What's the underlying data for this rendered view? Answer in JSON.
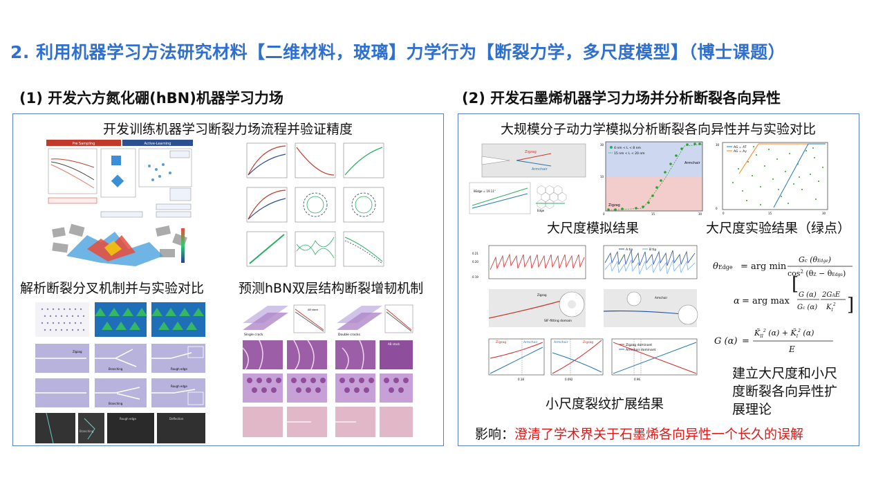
{
  "page": {
    "title": "2. 利用机器学习方法研究材料【二维材料，玻璃】力学行为【断裂力学，多尺度模型】（博士课题）"
  },
  "left": {
    "heading": "(1) 开发六方氮化硼(hBN)机器学习力场",
    "cap_top": "开发训练机器学习断裂力场流程并验证精度",
    "cap_bottom_left": "解析断裂分叉机制并与实验对比",
    "cap_bottom_right": "预测hBN双层结构断裂增韧机制"
  },
  "right": {
    "heading": "(2) 开发石墨烯机器学习力场并分析断裂各向异性",
    "cap_top": "大规模分子动力学模拟分析断裂各向异性并与实验对比",
    "cap_sim": "大尺度模拟结果",
    "cap_exp": "大尺度实验结果（绿点）",
    "cap_crack": "小尺度裂纹扩展结果",
    "cap_theory": [
      "建立大尺度和小尺",
      "度断裂各向异性扩",
      "展理论"
    ],
    "impact_label": "影响：",
    "impact_text": "澄清了学术界关于石墨烯各向异性一个长久的误解"
  },
  "figure_labels": {
    "pre_sampling": "Pre Sampling",
    "active_learning": "Active-Learning",
    "zigzag": "Zigzag",
    "armchair": "Armchair",
    "branching": "Branching",
    "rough_edge": "Rough edge",
    "deflection": "Deflection",
    "single_crack": "Single crack",
    "double_cracks": "Double cracks",
    "ab_stack": "AB stack",
    "legend_small": "4 nm < L < 8 nm",
    "legend_large": "15 nm < L < 20 nm",
    "edge": "Edge",
    "theta_edge_val": "θEdge = 19.11°",
    "a_tip": "A tip",
    "b_tip": "B tip",
    "sif_domain": "SIF-fitting domain",
    "zig_dom": "Zigzag dominant",
    "arm_dom": "Armchair dominant",
    "ag_at": "AG = AT",
    "ag_ag": "AG = Aγ",
    "tick_018": "0.18",
    "tick_0092": "0.092",
    "tick_096": "0.96"
  },
  "colors": {
    "title_blue": "#2e6fd0",
    "panel_border": "#5b7fc4",
    "impact_red": "#e01818",
    "sim_green": "#2ca02c",
    "curve_red": "#d62728",
    "curve_blue": "#1f77b4"
  }
}
